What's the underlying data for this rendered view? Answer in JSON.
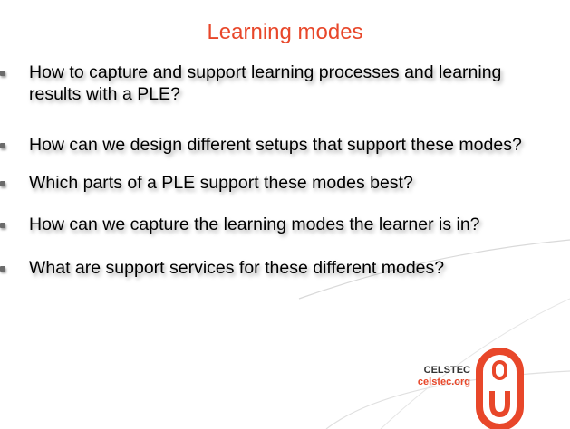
{
  "slide": {
    "title": "Learning modes",
    "bullets": [
      "How to capture and support learning processes and learning results with a PLE?",
      "How can we design different setups that support these modes?",
      "Which parts of a PLE support these modes best?",
      "How can we capture the learning modes the learner is in?",
      "What are support services for these different modes?"
    ]
  },
  "logo": {
    "name": "CELSTEC",
    "url": "celstec.org",
    "accent_color": "#e8472a"
  }
}
